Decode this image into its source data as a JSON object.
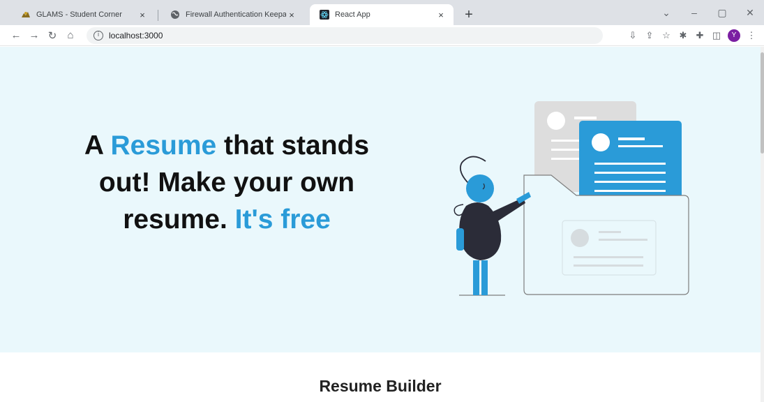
{
  "browser": {
    "tabs": [
      {
        "title": "GLAMS - Student Corner",
        "icon": "glams-favicon-icon",
        "active": false
      },
      {
        "title": "Firewall Authentication Keepalive",
        "icon": "globe-icon",
        "active": false
      },
      {
        "title": "React App",
        "icon": "react-favicon-icon",
        "active": true
      }
    ],
    "close_glyph": "×",
    "new_tab_glyph": "+",
    "address": "localhost:3000",
    "profile_initial": "Y"
  },
  "hero": {
    "heading_parts": [
      "A ",
      "Resume",
      " that stands out! Make your own resume. ",
      "It's free"
    ],
    "accent_color": "#2a9bd8",
    "background": "#eaf8fc"
  },
  "section": {
    "title": "Resume Builder"
  }
}
